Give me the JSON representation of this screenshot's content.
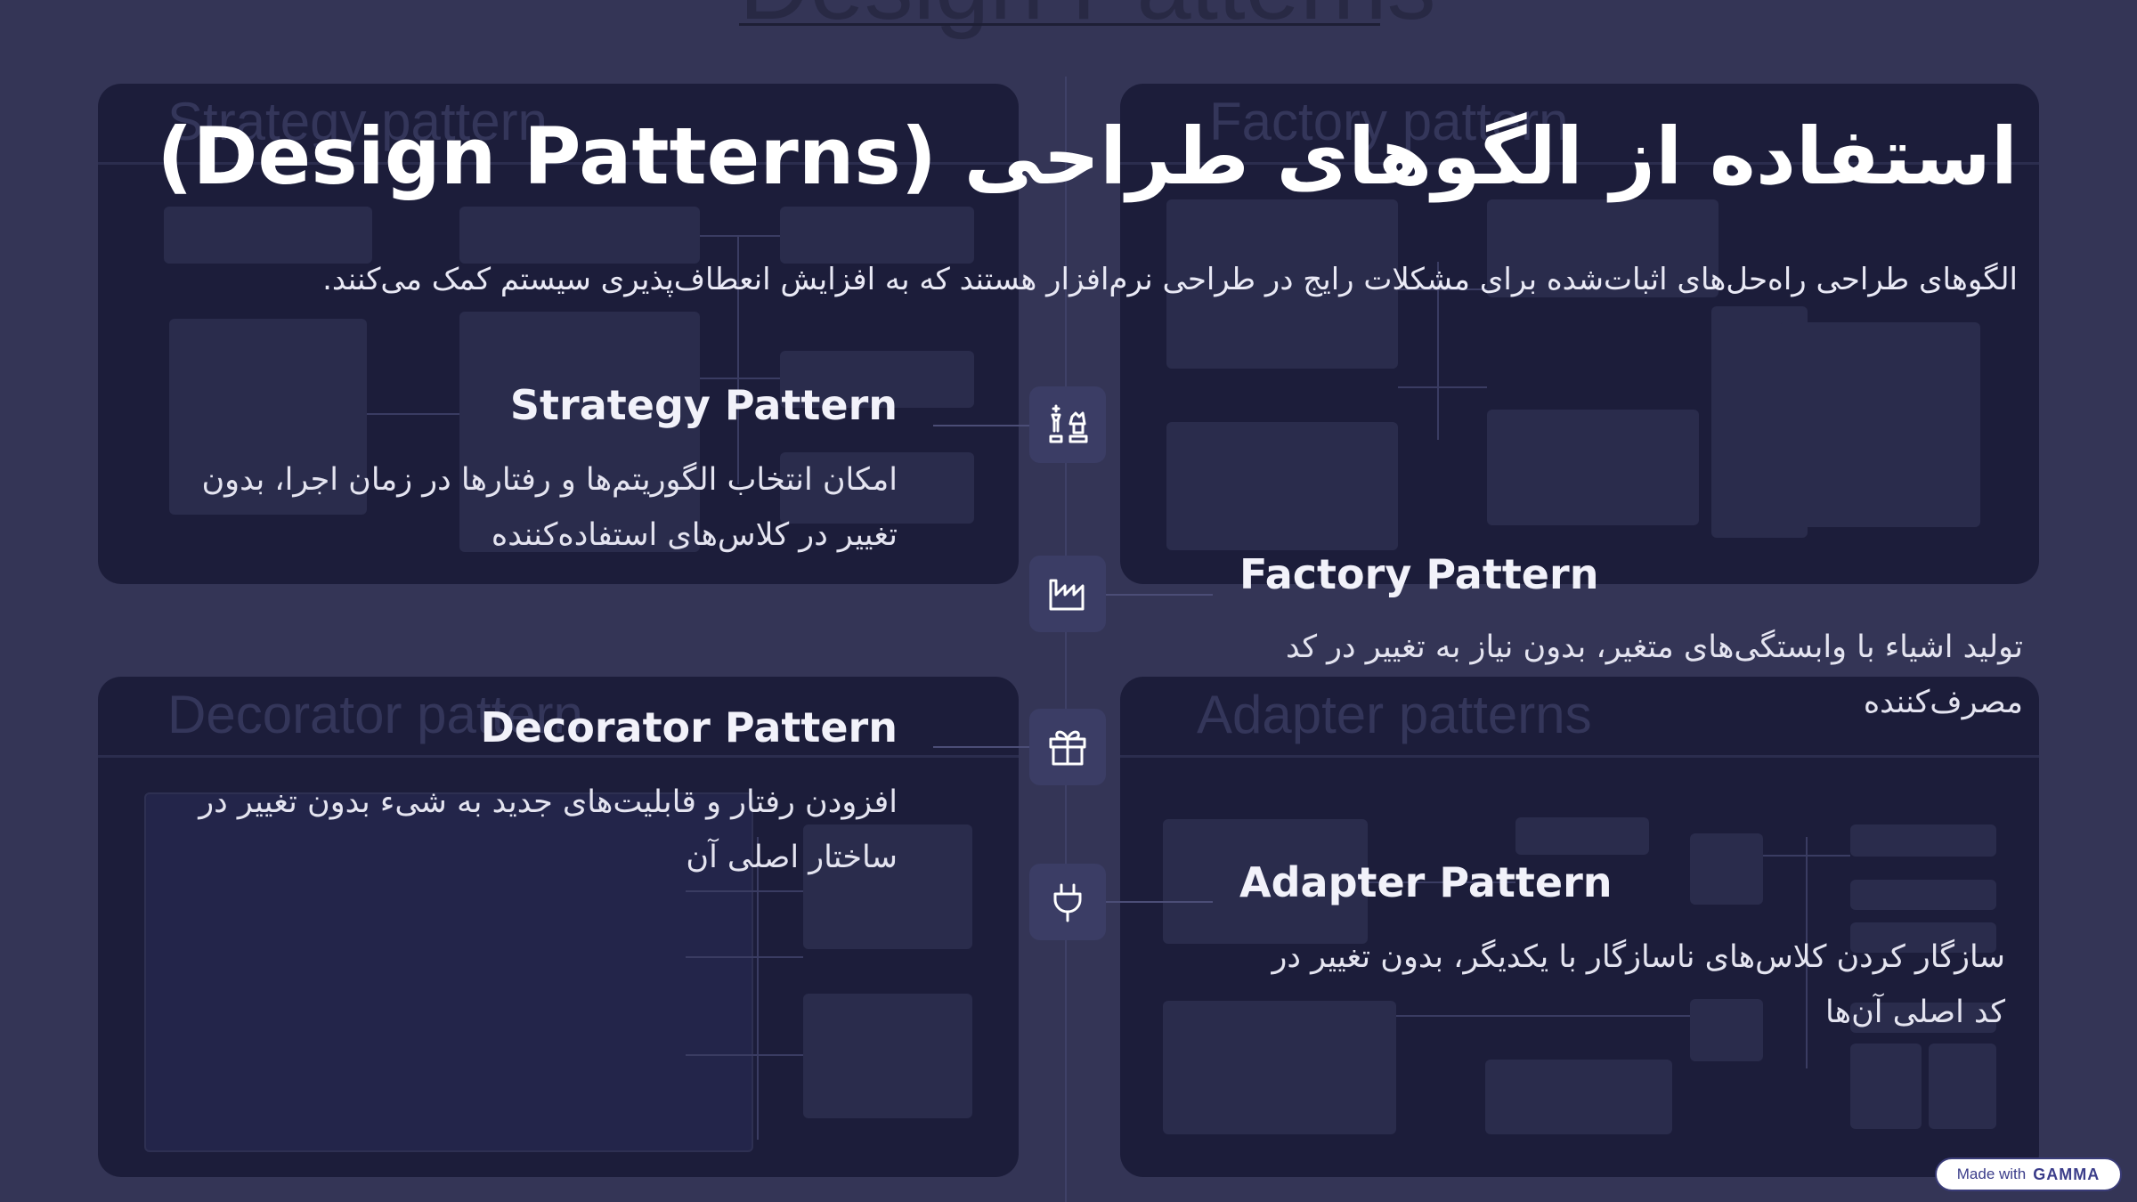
{
  "background_title": "Design Patterns",
  "panels": {
    "strategy": "Strategy pattern",
    "factory": "Factory pattern",
    "decorator": "Decorator pattern",
    "adapter": "Adapter patterns"
  },
  "title": "استفاده از الگوهای طراحی (Design Patterns)",
  "intro": "الگوهای طراحی راه‌حل‌های اثبات‌شده برای مشکلات رایج در طراحی نرم‌افزار هستند که به افزایش انعطاف‌پذیری سیستم کمک می‌کنند.",
  "items": [
    {
      "title": "Strategy Pattern",
      "description": "امکان انتخاب الگوریتم‌ها و رفتارها در زمان اجرا، بدون تغییر در کلاس‌های استفاده‌کننده",
      "icon": "chess-pieces-icon"
    },
    {
      "title": "Factory Pattern",
      "description": "تولید اشیاء با وابستگی‌های متغیر، بدون نیاز به تغییر در کد مصرف‌کننده",
      "icon": "factory-icon"
    },
    {
      "title": "Decorator Pattern",
      "description": "افزودن رفتار و قابلیت‌های جدید به شیء بدون تغییر در ساختار اصلی آن",
      "icon": "gift-icon"
    },
    {
      "title": "Adapter Pattern",
      "description": "سازگار کردن کلاس‌های ناسازگار با یکدیگر، بدون تغییر در کد اصلی آن‌ها",
      "icon": "plug-icon"
    }
  ],
  "badge": {
    "prefix": "Made with",
    "brand": "GAMMA"
  }
}
